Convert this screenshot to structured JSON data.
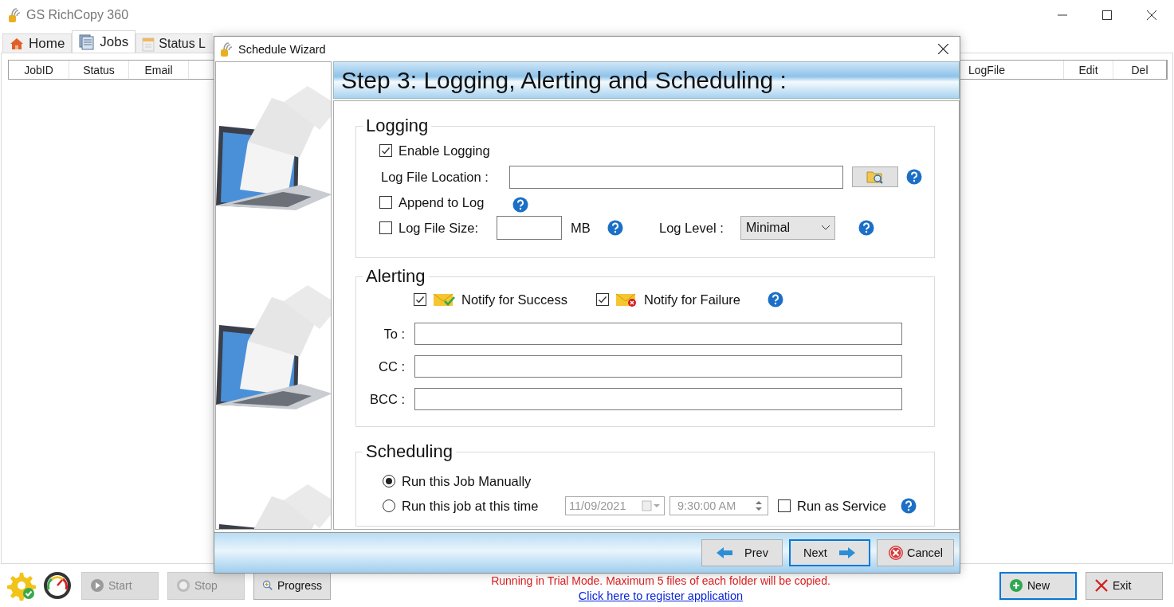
{
  "window": {
    "title": "GS RichCopy 360"
  },
  "tabs": [
    {
      "label": "Home",
      "selected": false
    },
    {
      "label": "Jobs",
      "selected": true
    },
    {
      "label": "Status L",
      "selected": false
    }
  ],
  "table": {
    "columns": [
      {
        "label": "JobID"
      },
      {
        "label": "Status"
      },
      {
        "label": "Email"
      },
      {
        "label": "LogFile"
      },
      {
        "label": "Edit"
      },
      {
        "label": "Del"
      }
    ]
  },
  "wizard": {
    "title": "Schedule Wizard",
    "step_title": "Step 3: Logging, Alerting and Scheduling :",
    "logging": {
      "heading": "Logging",
      "enable_logging": {
        "label": "Enable Logging",
        "checked": true
      },
      "log_file_location": {
        "label": "Log File Location :"
      },
      "append_to_log": {
        "label": "Append to Log",
        "checked": false
      },
      "log_file_size": {
        "label": "Log File Size:",
        "checked": false,
        "unit": "MB"
      },
      "log_level": {
        "label": "Log Level :",
        "value": "Minimal"
      }
    },
    "alerting": {
      "heading": "Alerting",
      "notify": [
        {
          "label": "Notify for Success",
          "checked": true,
          "kind": "success"
        },
        {
          "label": "Notify for Failure",
          "checked": true,
          "kind": "failure"
        }
      ],
      "fields": [
        {
          "label": "To :"
        },
        {
          "label": "CC :"
        },
        {
          "label": "BCC :"
        }
      ]
    },
    "scheduling": {
      "heading": "Scheduling",
      "options": [
        {
          "label": "Run this Job Manually",
          "selected": true
        },
        {
          "label": "Run this job at this time",
          "selected": false
        }
      ],
      "date": {
        "value": "11/09/2021",
        "disabled": true
      },
      "time": {
        "value": "9:30:00 AM",
        "disabled": true
      },
      "run_as_service": {
        "label": "Run as Service",
        "checked": false
      }
    },
    "buttons": [
      {
        "label": "Prev",
        "kind": "prev",
        "focused": false
      },
      {
        "label": "Next",
        "kind": "next",
        "focused": true
      },
      {
        "label": "Cancel",
        "kind": "cancel",
        "focused": false
      }
    ]
  },
  "toolbar": {
    "buttons": [
      {
        "label": "Start",
        "kind": "start",
        "disabled": true
      },
      {
        "label": "Stop",
        "kind": "stop",
        "disabled": true
      },
      {
        "label": "Progress",
        "kind": "progress",
        "disabled": false
      }
    ],
    "trial_message": "Running in Trial Mode. Maximum 5 files of each folder will be copied.",
    "register_link": "Click here to register application",
    "actions": [
      {
        "label": "New",
        "kind": "new",
        "focused": true
      },
      {
        "label": "Exit",
        "kind": "exit",
        "focused": false
      }
    ]
  }
}
